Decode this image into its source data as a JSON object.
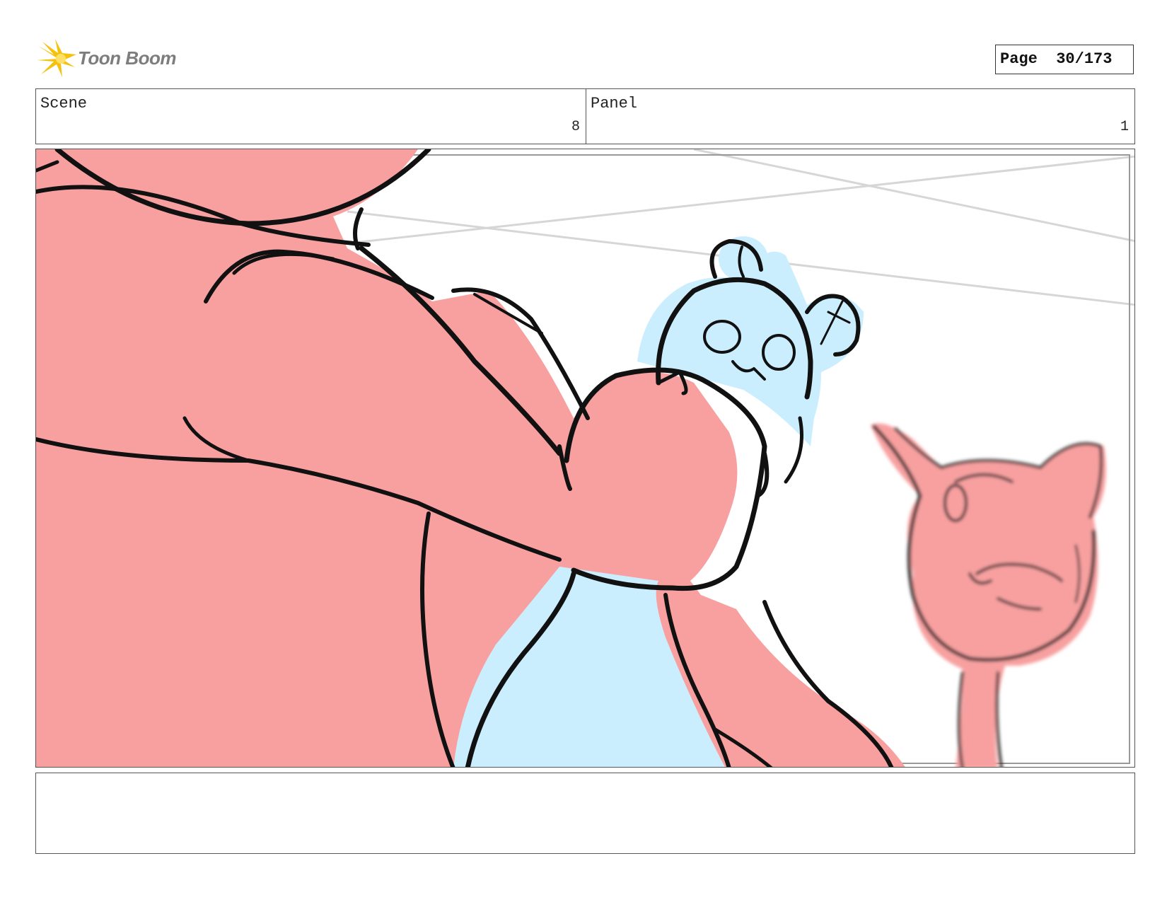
{
  "logo": {
    "brand": "Toon Boom",
    "accent": "#f4c20d"
  },
  "page": {
    "label": "Page",
    "number": "30/173"
  },
  "scene": {
    "label": "Scene",
    "value": "8"
  },
  "panel": {
    "label": "Panel",
    "value": "1"
  },
  "colors": {
    "character_pink": "#f8a0a0",
    "character_blue": "#cbeeff",
    "ink": "#111111",
    "guide_lines": "#d0d0d0"
  },
  "notes": {
    "text": ""
  }
}
